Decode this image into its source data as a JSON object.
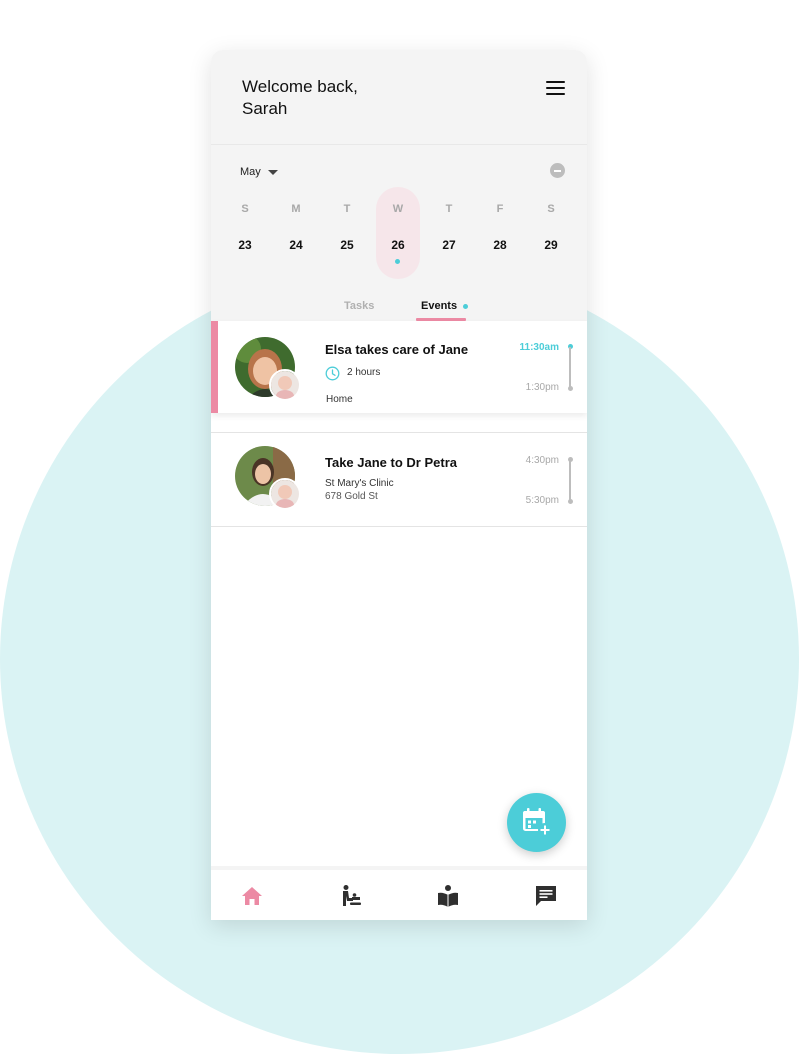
{
  "header": {
    "welcome_line1": "Welcome back,",
    "welcome_line2": "Sarah",
    "menu_icon": "hamburger-menu-icon"
  },
  "calendar": {
    "month": "May",
    "selected_day": "26",
    "days": [
      {
        "letter": "S",
        "num": "23"
      },
      {
        "letter": "M",
        "num": "24"
      },
      {
        "letter": "T",
        "num": "25"
      },
      {
        "letter": "W",
        "num": "26"
      },
      {
        "letter": "T",
        "num": "27"
      },
      {
        "letter": "F",
        "num": "28"
      },
      {
        "letter": "S",
        "num": "29"
      }
    ]
  },
  "tabs": {
    "tasks": "Tasks",
    "events": "Events",
    "active": "Events"
  },
  "events": [
    {
      "title": "Elsa takes care of Jane",
      "duration": "2 hours",
      "location": "Home",
      "start": "11:30am",
      "end": "1:30pm"
    },
    {
      "title": "Take Jane to Dr Petra",
      "place": "St Mary's Clinic",
      "address": "678 Gold St",
      "start": "4:30pm",
      "end": "5:30pm"
    }
  ],
  "fab": {
    "icon": "calendar-add-icon"
  },
  "bottom_nav": [
    {
      "icon": "home-icon",
      "active": true
    },
    {
      "icon": "baby-changing-icon",
      "active": false
    },
    {
      "icon": "reading-book-icon",
      "active": false
    },
    {
      "icon": "chat-icon",
      "active": false
    }
  ],
  "colors": {
    "accent_pink": "#ec8aa4",
    "accent_teal": "#4ccdd8",
    "background_circle": "#daf3f4",
    "panel_grey": "#f4f4f4"
  }
}
